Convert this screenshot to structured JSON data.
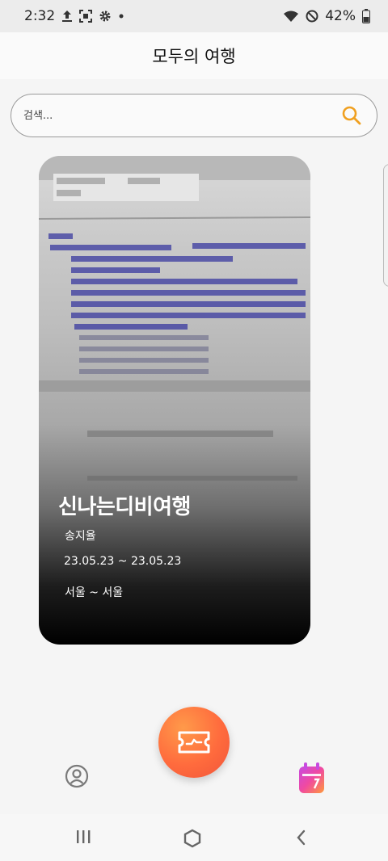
{
  "status_bar": {
    "time": "2:32",
    "battery": "42%",
    "icons": [
      "upload-icon",
      "screenshot-icon",
      "settings-icon",
      "dot-icon",
      "wifi-icon",
      "do-not-disturb-icon",
      "battery-icon"
    ]
  },
  "header": {
    "title": "모두의 여행"
  },
  "search": {
    "placeholder": "검색..."
  },
  "trip_card": {
    "title": "신나는디비여행",
    "name": "송지율",
    "dates": "23.05.23 ~ 23.05.23",
    "route": "서울 ~ 서울",
    "photo_icon": "code-screen-photo"
  },
  "bottom_nav": {
    "items": [
      {
        "icon": "profile-icon"
      },
      {
        "icon": "ticket-icon"
      },
      {
        "icon": "calendar-icon"
      }
    ]
  },
  "system_nav": {
    "icons": [
      "recent-apps-icon",
      "home-icon",
      "back-icon"
    ]
  },
  "colors": {
    "accent_orange": "#FF7A3D",
    "search_icon": "#F0A020",
    "calendar_pink": "#F04AA0",
    "calendar_orange": "#FF9A3A"
  }
}
